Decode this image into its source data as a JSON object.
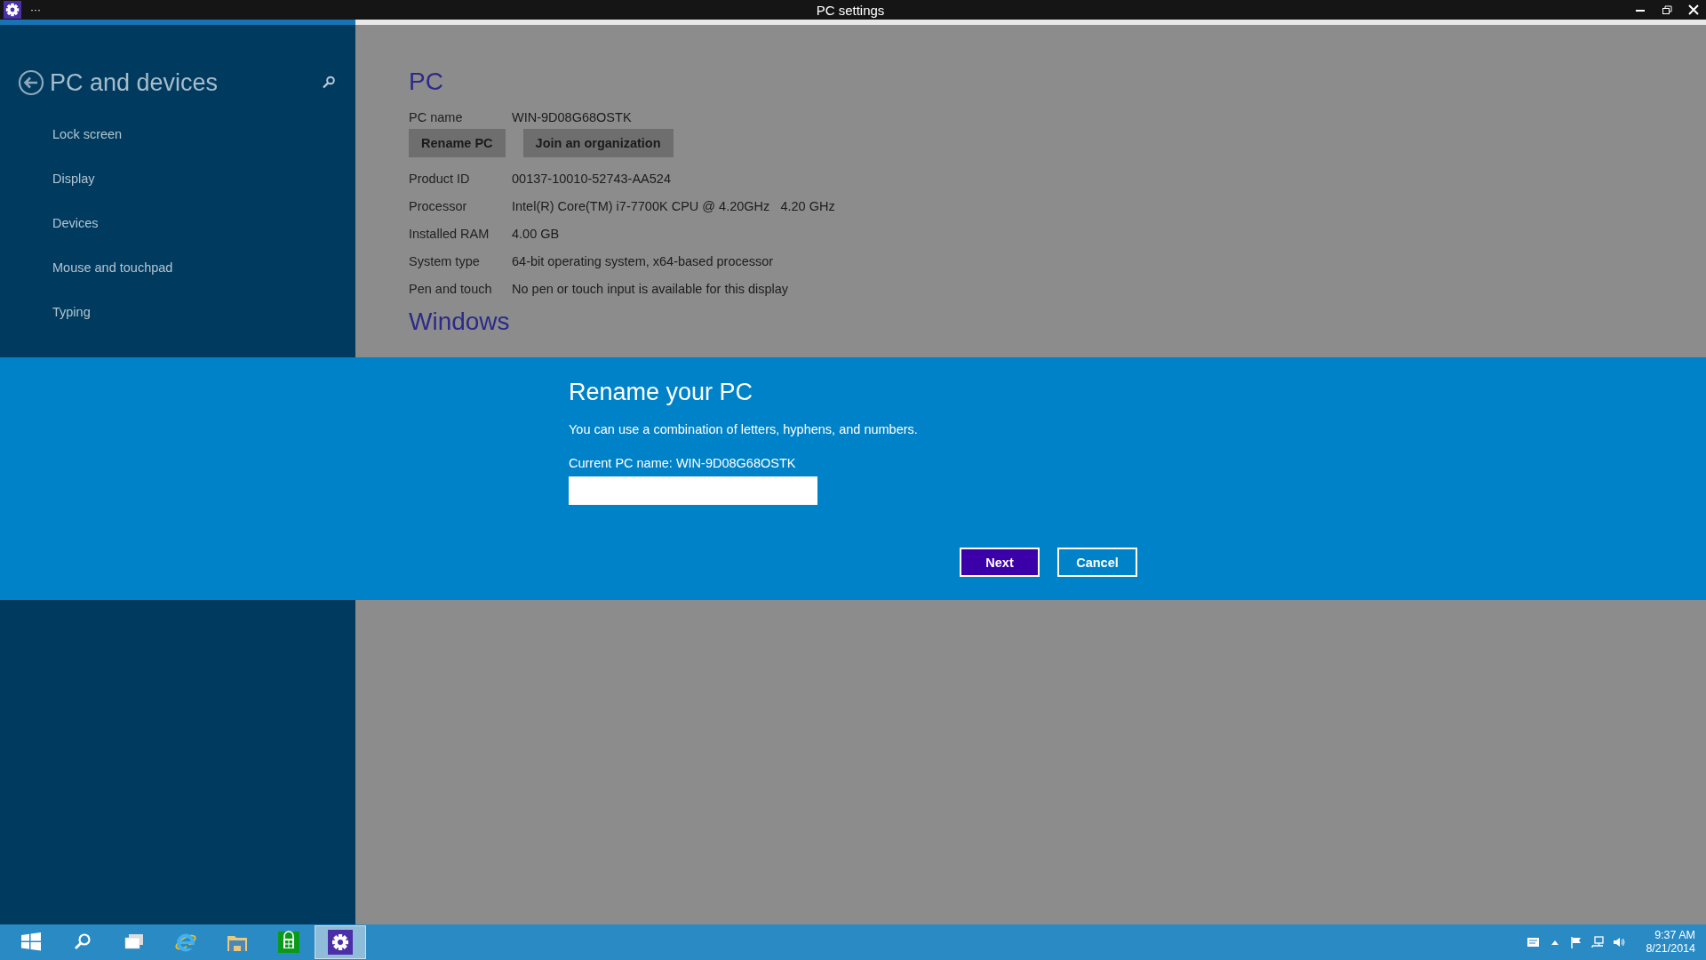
{
  "window": {
    "title": "PC settings",
    "menu": "···"
  },
  "sidebar": {
    "title": "PC and devices",
    "items": [
      {
        "label": "Lock screen"
      },
      {
        "label": "Display"
      },
      {
        "label": "Devices"
      },
      {
        "label": "Mouse and touchpad"
      },
      {
        "label": "Typing"
      }
    ]
  },
  "section": {
    "heading": "PC",
    "pc_name": {
      "label": "PC name",
      "value": "WIN-9D08G68OSTK"
    },
    "buttons": [
      "Rename PC",
      "Join an organization"
    ],
    "properties": [
      {
        "label": "Product ID",
        "value": "00137-10010-52743-AA524"
      },
      {
        "label": "Processor",
        "value": "Intel(R) Core(TM) i7-7700K CPU @ 4.20GHz   4.20 GHz"
      },
      {
        "label": "Installed RAM",
        "value": "4.00 GB"
      },
      {
        "label": "System type",
        "value": "64-bit operating system, x64-based processor"
      },
      {
        "label": "Pen and touch",
        "value": "No pen or touch input is available for this display"
      }
    ],
    "next_heading": "Windows"
  },
  "dialog": {
    "title": "Rename your PC",
    "description": "You can use a combination of letters, hyphens, and numbers.",
    "current_name": "Current PC name: WIN-9D08G68OSTK",
    "buttons": [
      {
        "label": "Next",
        "kind": "primary"
      },
      {
        "label": "Cancel",
        "kind": "secondary"
      }
    ]
  },
  "taskbar": {
    "apps": [
      {
        "kind": "start",
        "selected": false
      },
      {
        "kind": "search",
        "selected": false
      },
      {
        "kind": "task-view",
        "selected": false
      },
      {
        "kind": "browser",
        "selected": false
      },
      {
        "kind": "folder",
        "selected": false
      },
      {
        "kind": "store",
        "selected": false
      },
      {
        "kind": "settings",
        "selected": true
      }
    ],
    "clock": {
      "time": "9:37 AM",
      "date": "8/21/2014"
    }
  }
}
